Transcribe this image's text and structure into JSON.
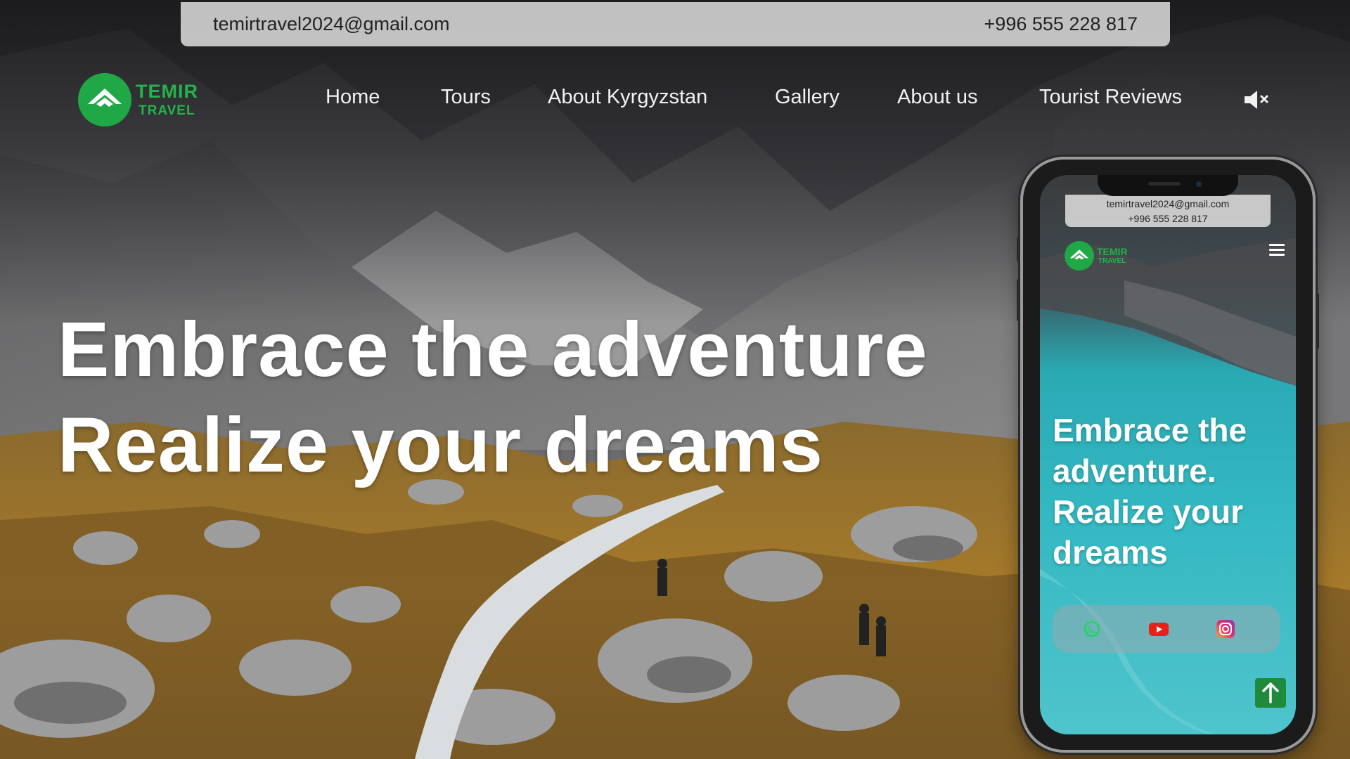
{
  "contact": {
    "email": "temirtravel2024@gmail.com",
    "phone": "+996 555 228 817"
  },
  "logo": {
    "line1": "TEMIR",
    "line2": "TRAVEL"
  },
  "nav": {
    "items": [
      {
        "label": "Home"
      },
      {
        "label": "Tours"
      },
      {
        "label": "About Kyrgyzstan"
      },
      {
        "label": "Gallery"
      },
      {
        "label": "About us"
      },
      {
        "label": "Tourist Reviews"
      }
    ],
    "mute_icon": "speaker-muted-icon"
  },
  "hero": {
    "line1": "Embrace the adventure",
    "line2": "Realize your dreams"
  },
  "mobile": {
    "email": "temirtravel2024@gmail.com",
    "phone": "+996 555 228 817",
    "logo_line1": "TEMIR",
    "logo_line2": "TRAVEL",
    "hero": [
      "Embrace the",
      "adventure.",
      "Realize your",
      "dreams"
    ],
    "social_icons": [
      "whatsapp-icon",
      "youtube-icon",
      "instagram-icon"
    ],
    "scroll_top_icon": "arrow-up-icon",
    "menu_icon": "hamburger-menu-icon"
  },
  "colors": {
    "brand_green": "#23b34a",
    "nav_text": "#f2f2f2",
    "youtube_red": "#e62117",
    "instagram_pink": "#e1306c",
    "whatsapp_green": "#25d366"
  }
}
